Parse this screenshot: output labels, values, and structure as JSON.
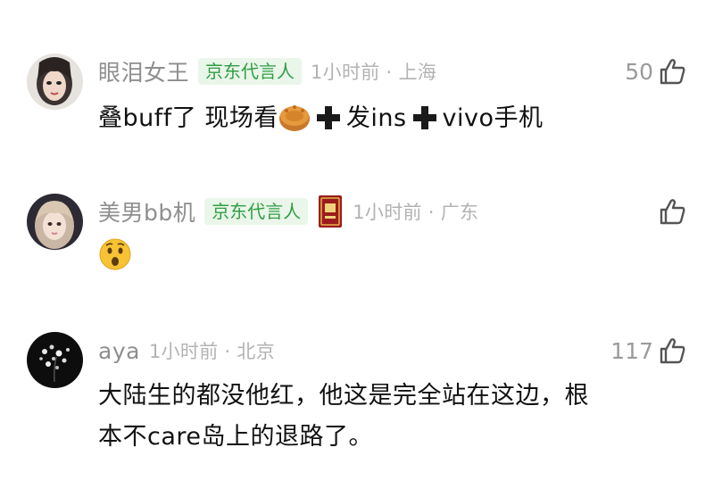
{
  "comments": [
    {
      "username": "眼泪女王",
      "badge": "京东代言人",
      "time_location": "1小时前 · 上海",
      "like_count": "50",
      "text_parts": [
        "叠buff了 现场看",
        "发ins",
        "vivo手机"
      ],
      "icons": [
        "user-avatar-girl",
        "mooncake-emoji",
        "plus-sign-emoji",
        "thumbs-up-icon"
      ]
    },
    {
      "username": "美男bb机",
      "badge": "京东代言人",
      "time_location": "1小时前 · 广东",
      "like_count": "",
      "text_parts": [],
      "icons": [
        "user-avatar-girl",
        "red-book-sticker",
        "surprised-face-emoji",
        "thumbs-up-icon"
      ]
    },
    {
      "username": "aya",
      "badge": "",
      "time_location": "1小时前 · 北京",
      "like_count": "117",
      "text_parts": [
        "大陆生的都没他红，他这是完全站在这边，根",
        "本不care岛上的退路了。"
      ],
      "icons": [
        "blossom-avatar",
        "thumbs-up-icon"
      ]
    }
  ],
  "colors": {
    "name": "#8e8e8e",
    "badge_text": "#2f9e44",
    "badge_bg": "#eaf6e9",
    "time": "#b3b3b3",
    "body_text": "#111111"
  }
}
